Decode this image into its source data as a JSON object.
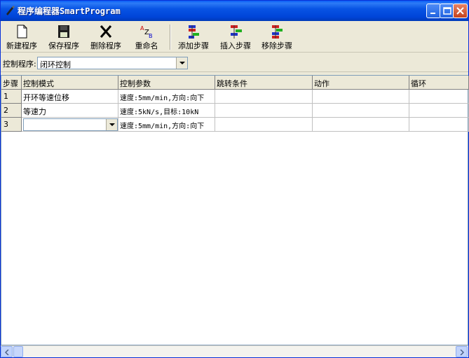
{
  "window": {
    "title": "程序编程器SmartProgram"
  },
  "toolbar": {
    "new_label": "新建程序",
    "save_label": "保存程序",
    "delete_label": "删除程序",
    "rename_label": "重命名",
    "add_step_label": "添加步骤",
    "insert_step_label": "插入步骤",
    "remove_step_label": "移除步骤"
  },
  "program": {
    "label": "控制程序:",
    "selected": "闭环控制"
  },
  "grid": {
    "columns": [
      "步骤",
      "控制模式",
      "控制参数",
      "跳转条件",
      "动作",
      "循环"
    ],
    "rows": [
      {
        "step": "1",
        "mode": "开环等速位移",
        "params": "速度:5mm/min,方向:向下",
        "jump": "",
        "action": "",
        "loop": ""
      },
      {
        "step": "2",
        "mode": "等速力",
        "params": "速度:5kN/s,目标:10kN",
        "jump": "",
        "action": "",
        "loop": ""
      },
      {
        "step": "3",
        "mode": "",
        "params": "速度:5mm/min,方向:向下",
        "jump": "",
        "action": "",
        "loop": ""
      }
    ]
  }
}
